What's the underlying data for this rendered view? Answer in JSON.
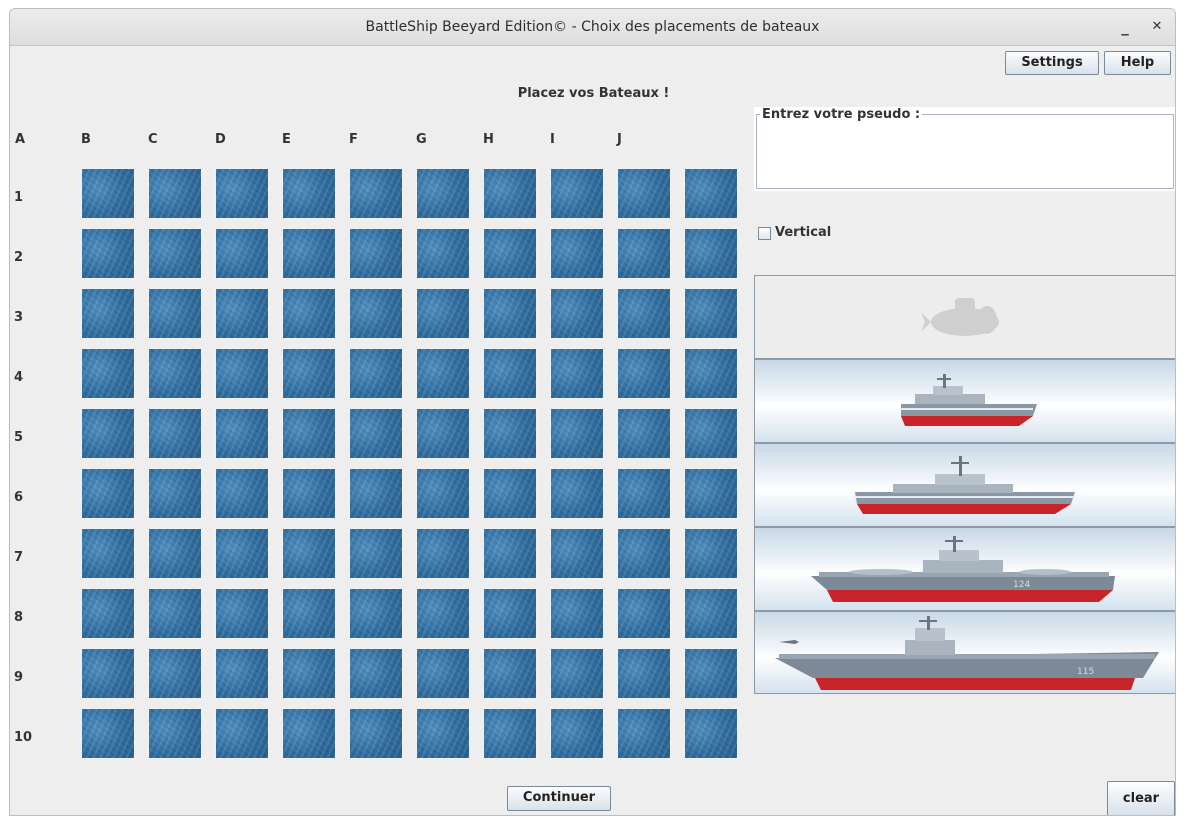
{
  "window": {
    "title": "BattleShip Beeyard Edition© - Choix des placements de bateaux",
    "minimize_label": "_",
    "close_label": "✕"
  },
  "toolbar": {
    "settings_label": "Settings",
    "help_label": "Help"
  },
  "heading": "Placez vos Bateaux !",
  "grid": {
    "column_labels": [
      "A",
      "B",
      "C",
      "D",
      "E",
      "F",
      "G",
      "H",
      "I",
      "J"
    ],
    "row_labels": [
      "1",
      "2",
      "3",
      "4",
      "5",
      "6",
      "7",
      "8",
      "9",
      "10"
    ],
    "cell_texture": "sea-water"
  },
  "pseudo": {
    "legend": "Entrez votre pseudo :",
    "value": ""
  },
  "vertical": {
    "label": "Vertical",
    "checked": false
  },
  "ships": [
    {
      "icon": "submarine-icon",
      "state": "placed",
      "hull_number": ""
    },
    {
      "icon": "patrol-boat-icon",
      "state": "available",
      "hull_number": ""
    },
    {
      "icon": "destroyer-icon",
      "state": "available",
      "hull_number": ""
    },
    {
      "icon": "cruiser-icon",
      "state": "available",
      "hull_number": "124"
    },
    {
      "icon": "aircraft-carrier-icon",
      "state": "available",
      "hull_number": "115"
    }
  ],
  "buttons": {
    "continue_label": "Continuer",
    "clear_label": "clear"
  },
  "colors": {
    "sea": "#2f6d9f",
    "hull_red": "#c8252a",
    "hull_grey": "#8a97a4",
    "panel_bg": "#eeeeee"
  }
}
